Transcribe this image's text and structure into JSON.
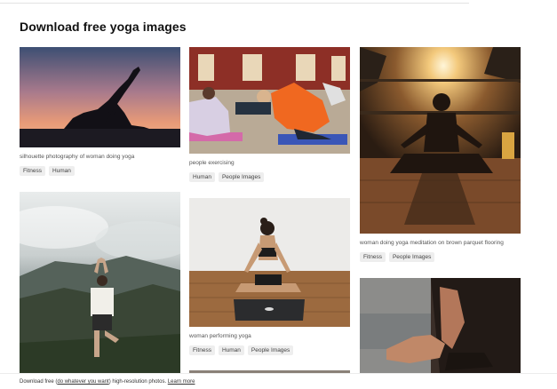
{
  "page": {
    "title": "Download free yoga images"
  },
  "cards": [
    {
      "caption": "silhouette photography of woman doing yoga",
      "tags": [
        "Fitness",
        "Human"
      ]
    },
    {
      "caption": "people exercising",
      "tags": [
        "Human",
        "People Images"
      ]
    },
    {
      "caption": "woman doing yoga meditation on brown parquet flooring",
      "tags": [
        "Fitness",
        "People Images"
      ]
    },
    {
      "caption": "",
      "tags": []
    },
    {
      "caption": "woman performing yoga",
      "tags": [
        "Fitness",
        "Human",
        "People Images"
      ]
    },
    {
      "caption": "",
      "tags": []
    }
  ],
  "footer": {
    "text_start": "Download free (",
    "link_text": "do whatever you want",
    "text_end": ") high-resolution photos.",
    "learn_more": "Learn more"
  }
}
